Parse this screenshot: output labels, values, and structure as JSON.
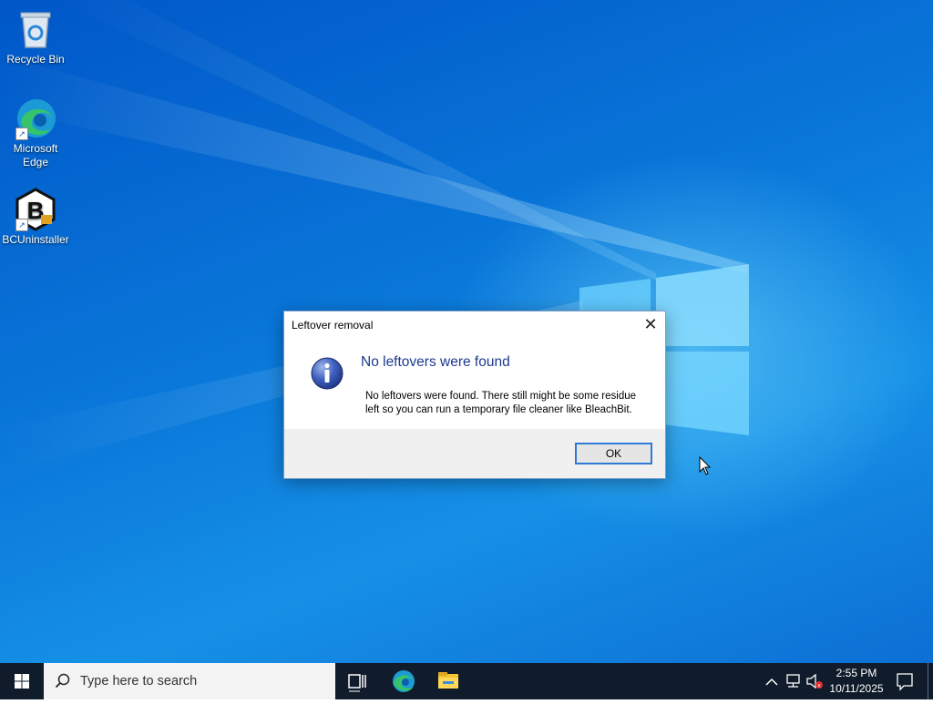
{
  "desktop": {
    "icons": [
      {
        "label": "Recycle Bin",
        "icon": "recycle-bin-icon"
      },
      {
        "label": "Microsoft Edge",
        "icon": "edge-icon"
      },
      {
        "label": "BCUninstaller",
        "icon": "bcuninstaller-icon"
      }
    ]
  },
  "dialog": {
    "title": "Leftover removal",
    "heading": "No leftovers were found",
    "body_line1": "No leftovers were found. There still might be some residue",
    "body_line2": "left so you can run a temporary file cleaner like BleachBit.",
    "ok_label": "OK",
    "close_glyph": "✕"
  },
  "taskbar": {
    "search_placeholder": "Type here to search",
    "time": "2:55 PM",
    "date": "10/11/2025",
    "pinned": [
      "task-view-icon",
      "edge-icon",
      "file-explorer-icon"
    ]
  },
  "colors": {
    "desktop_blue": "#0a78da",
    "taskbar": "#101c2b",
    "dialog_heading": "#1c3a8f",
    "ok_border": "#2f7ad4"
  }
}
